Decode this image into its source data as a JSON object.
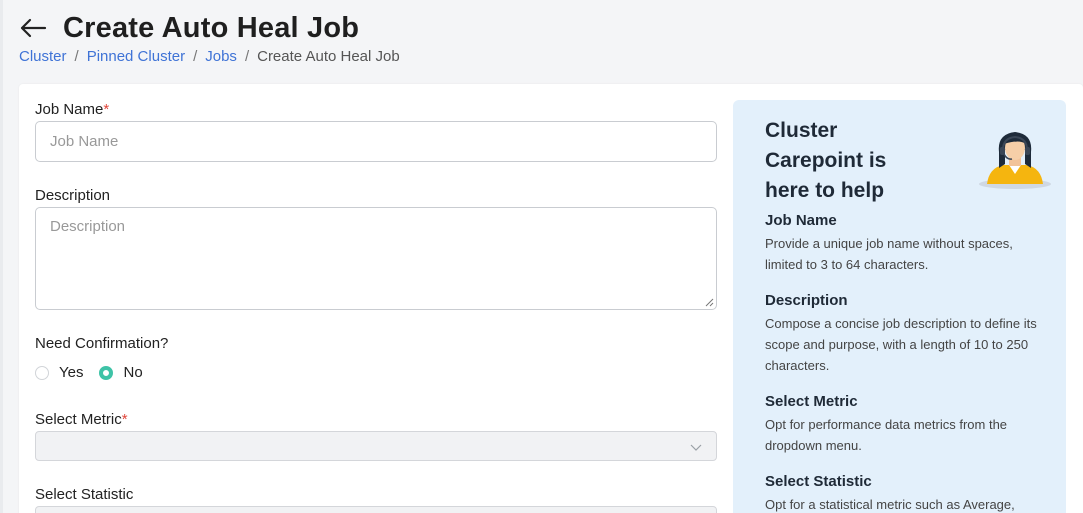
{
  "header": {
    "title": "Create Auto Heal Job",
    "back_icon": "arrow-left-icon"
  },
  "breadcrumb": {
    "items": [
      "Cluster",
      "Pinned Cluster",
      "Jobs"
    ],
    "current": "Create Auto Heal Job",
    "separator": "/"
  },
  "form": {
    "job_name": {
      "label": "Job Name",
      "required_mark": "*",
      "placeholder": "Job Name",
      "value": ""
    },
    "description": {
      "label": "Description",
      "placeholder": "Description",
      "value": ""
    },
    "confirmation": {
      "label": "Need Confirmation?",
      "options": [
        "Yes",
        "No"
      ],
      "selected": "No"
    },
    "metric": {
      "label": "Select Metric",
      "required_mark": "*",
      "value": ""
    },
    "statistic": {
      "label": "Select Statistic",
      "value": ""
    }
  },
  "help": {
    "title": "Cluster Carepoint is here to help",
    "avatar_icon": "support-agent-icon",
    "sections": [
      {
        "heading": "Job Name",
        "text": "Provide a unique job name without spaces, limited to 3 to 64 characters."
      },
      {
        "heading": "Description",
        "text": "Compose a concise job description to define its scope and purpose, with a length of 10 to 250 characters."
      },
      {
        "heading": "Select Metric",
        "text": "Opt for performance data metrics from the dropdown menu."
      },
      {
        "heading": "Select Statistic",
        "text": "Opt for a statistical metric such as Average,"
      }
    ]
  },
  "colors": {
    "link": "#3f73d6",
    "required": "#e0453a",
    "radio_accent": "#3ec3a7",
    "help_bg": "#e3f0fb"
  }
}
